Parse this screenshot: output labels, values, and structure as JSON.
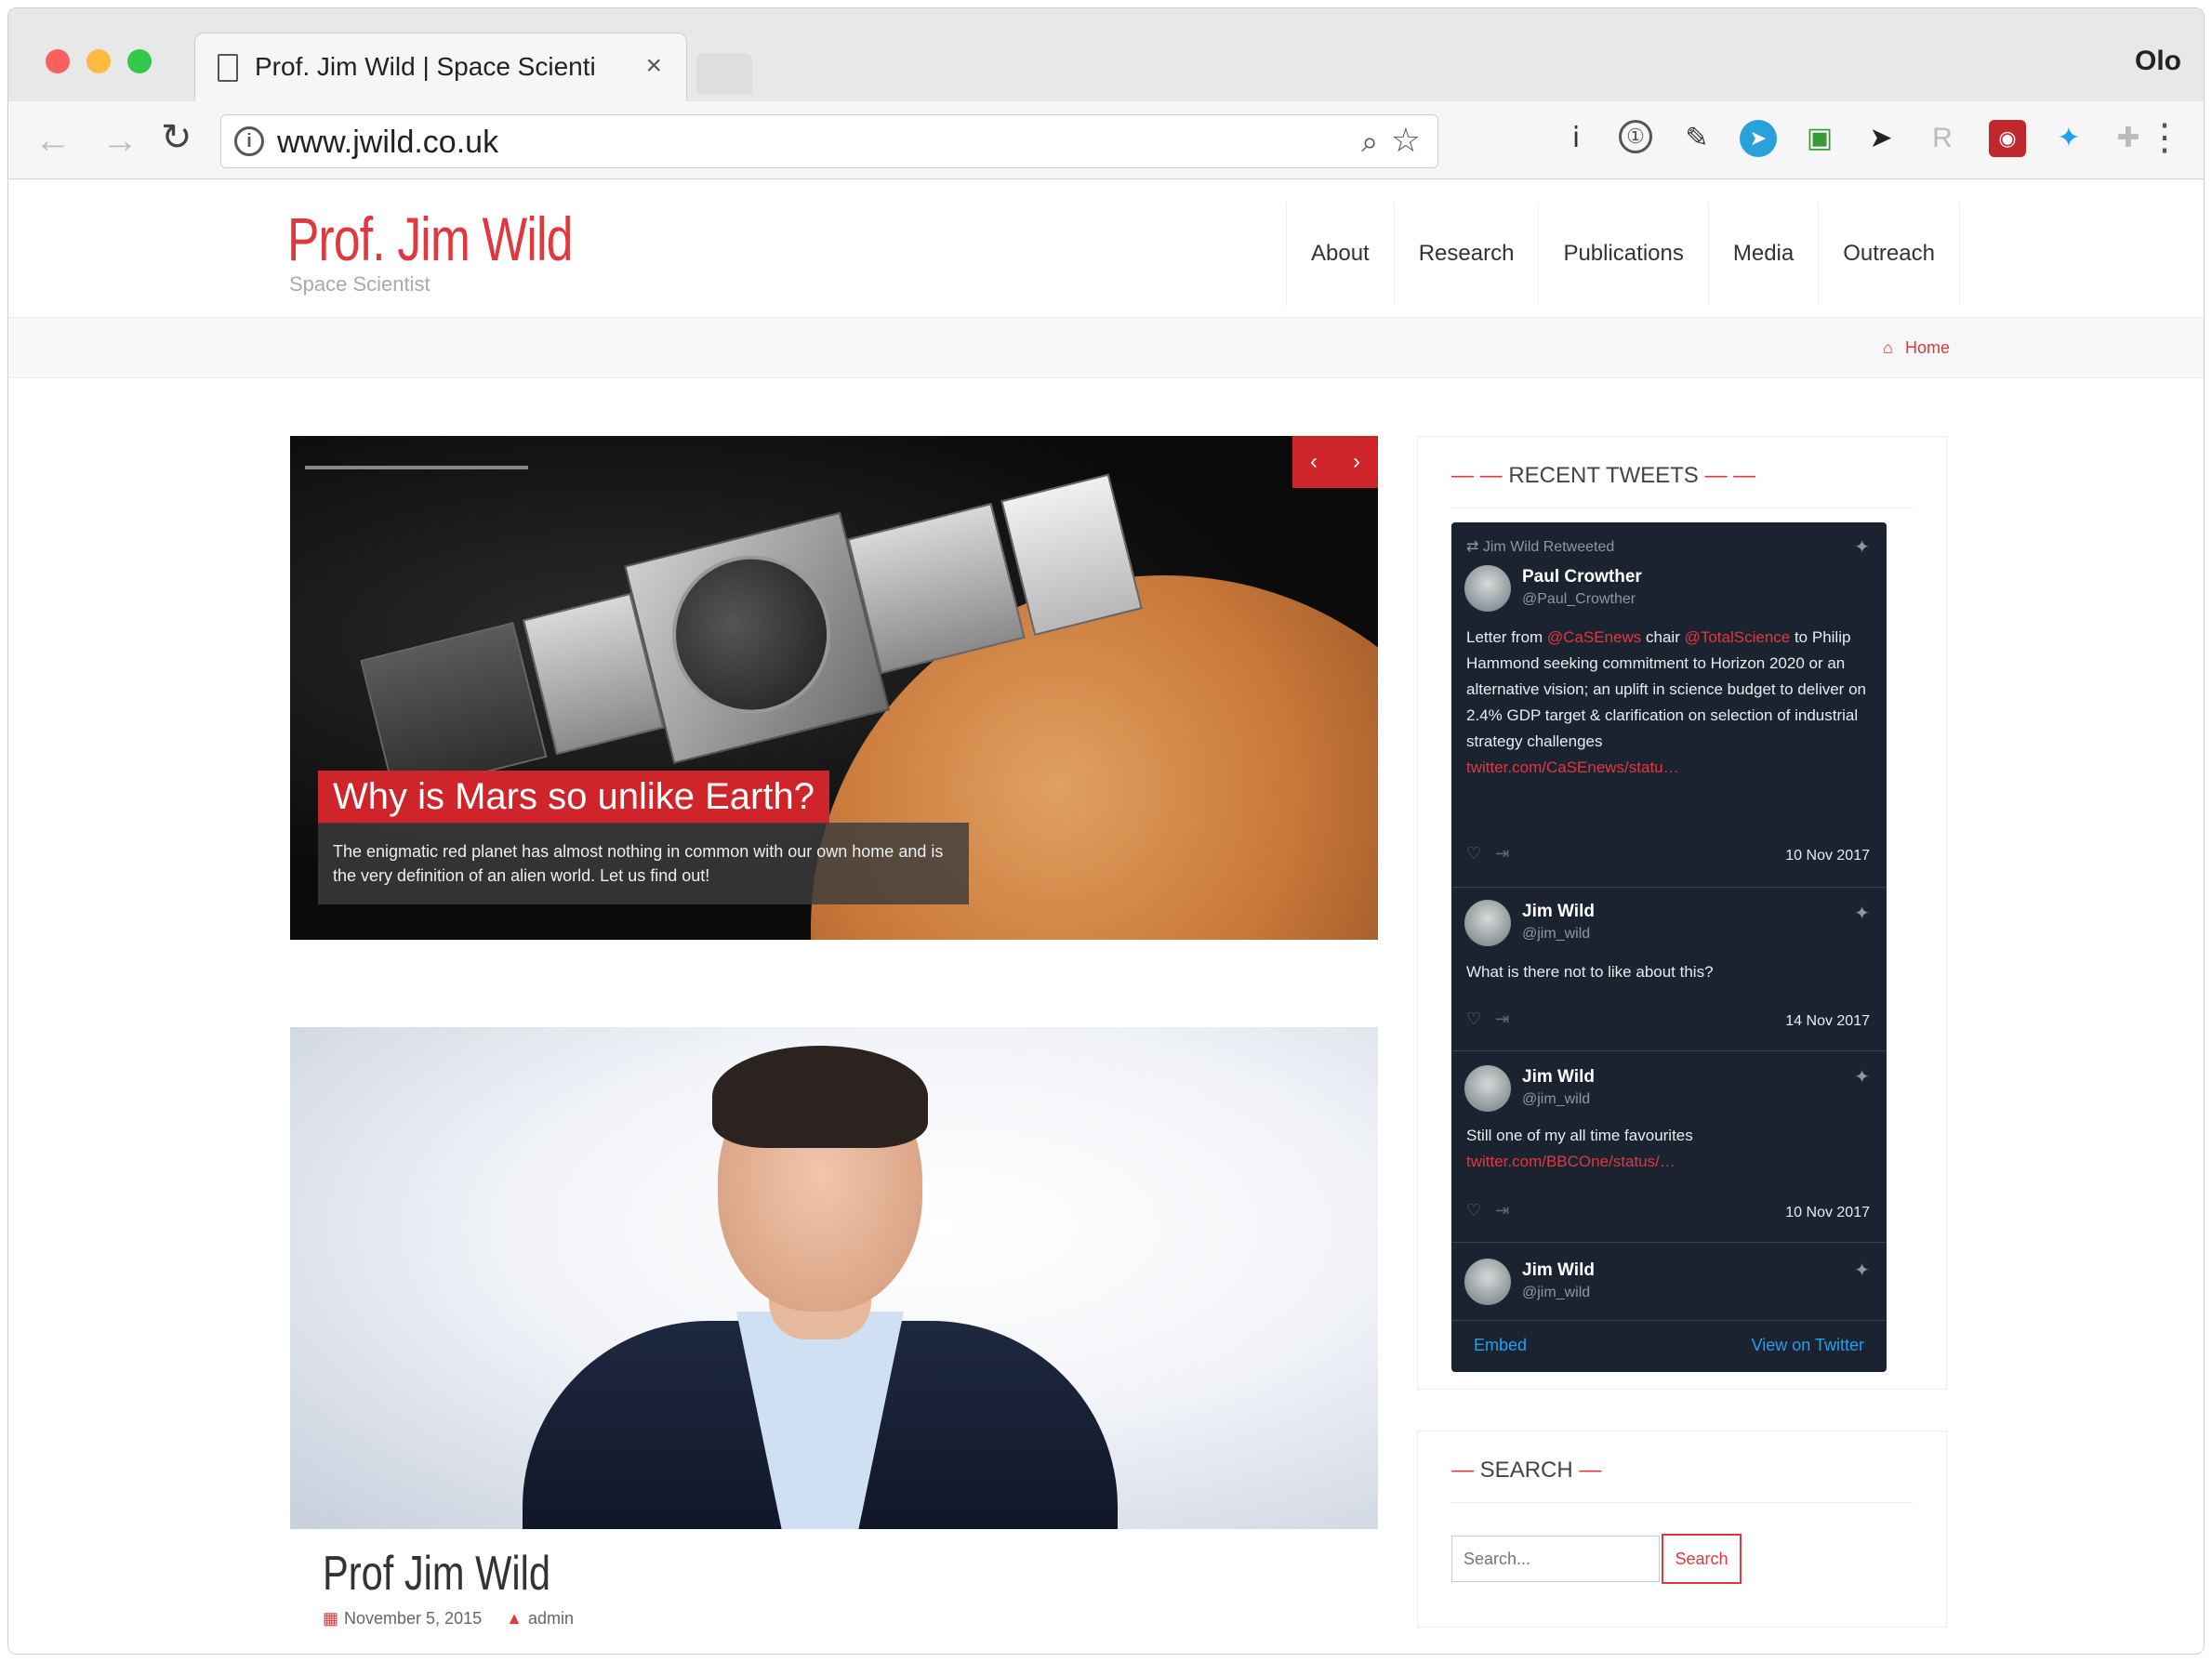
{
  "browser": {
    "tab_title": "Prof. Jim Wild | Space Scienti",
    "tab_close": "×",
    "profile_name": "Olo",
    "url": "www.jwild.co.uk",
    "ext_icons": [
      "info-icon",
      "evernote-icon",
      "telegram-icon",
      "pocket-icon",
      "arrow-icon",
      "r-icon",
      "lastpass-icon",
      "twitter-icon",
      "extension-icon"
    ]
  },
  "site": {
    "title": "Prof. Jim Wild",
    "tagline": "Space Scientist",
    "nav": [
      "About",
      "Research",
      "Publications",
      "Media",
      "Outreach"
    ],
    "breadcrumb_home": "Home"
  },
  "slider": {
    "caption_title": "Why is Mars so unlike Earth?",
    "caption_text": "The enigmatic red planet has almost nothing in common with our own home and is the very definition of an alien world. Let us find out!",
    "prev": "‹",
    "next": "›"
  },
  "post": {
    "title": "Prof Jim Wild",
    "date": "November 5, 2015",
    "author": "admin"
  },
  "tweets_widget": {
    "title": "RECENT TWEETS",
    "retweet_label": "Jim Wild Retweeted",
    "tweets": [
      {
        "name": "Paul Crowther",
        "handle": "@Paul_Crowther",
        "text_pre": "Letter from ",
        "link1": "@CaSEnews",
        "text_mid": " chair ",
        "link2": "@TotalScience",
        "text_post": " to Philip Hammond seeking commitment to Horizon 2020 or an alternative vision; an uplift in science budget to deliver on 2.4% GDP target & clarification on selection of industrial strategy challenges",
        "link3": "twitter.com/CaSEnews/statu…",
        "date": "10 Nov 2017"
      },
      {
        "name": "Jim Wild",
        "handle": "@jim_wild",
        "text_pre": "What is there not to like about this?",
        "date": "14 Nov 2017"
      },
      {
        "name": "Jim Wild",
        "handle": "@jim_wild",
        "text_pre": "Still one of my all time favourites",
        "link1": "twitter.com/BBCOne/status/…",
        "date": "10 Nov 2017"
      },
      {
        "name": "Jim Wild",
        "handle": "@jim_wild"
      }
    ],
    "embed_label": "Embed",
    "view_label": "View on Twitter"
  },
  "search_widget": {
    "title": "SEARCH",
    "placeholder": "Search...",
    "button": "Search"
  }
}
